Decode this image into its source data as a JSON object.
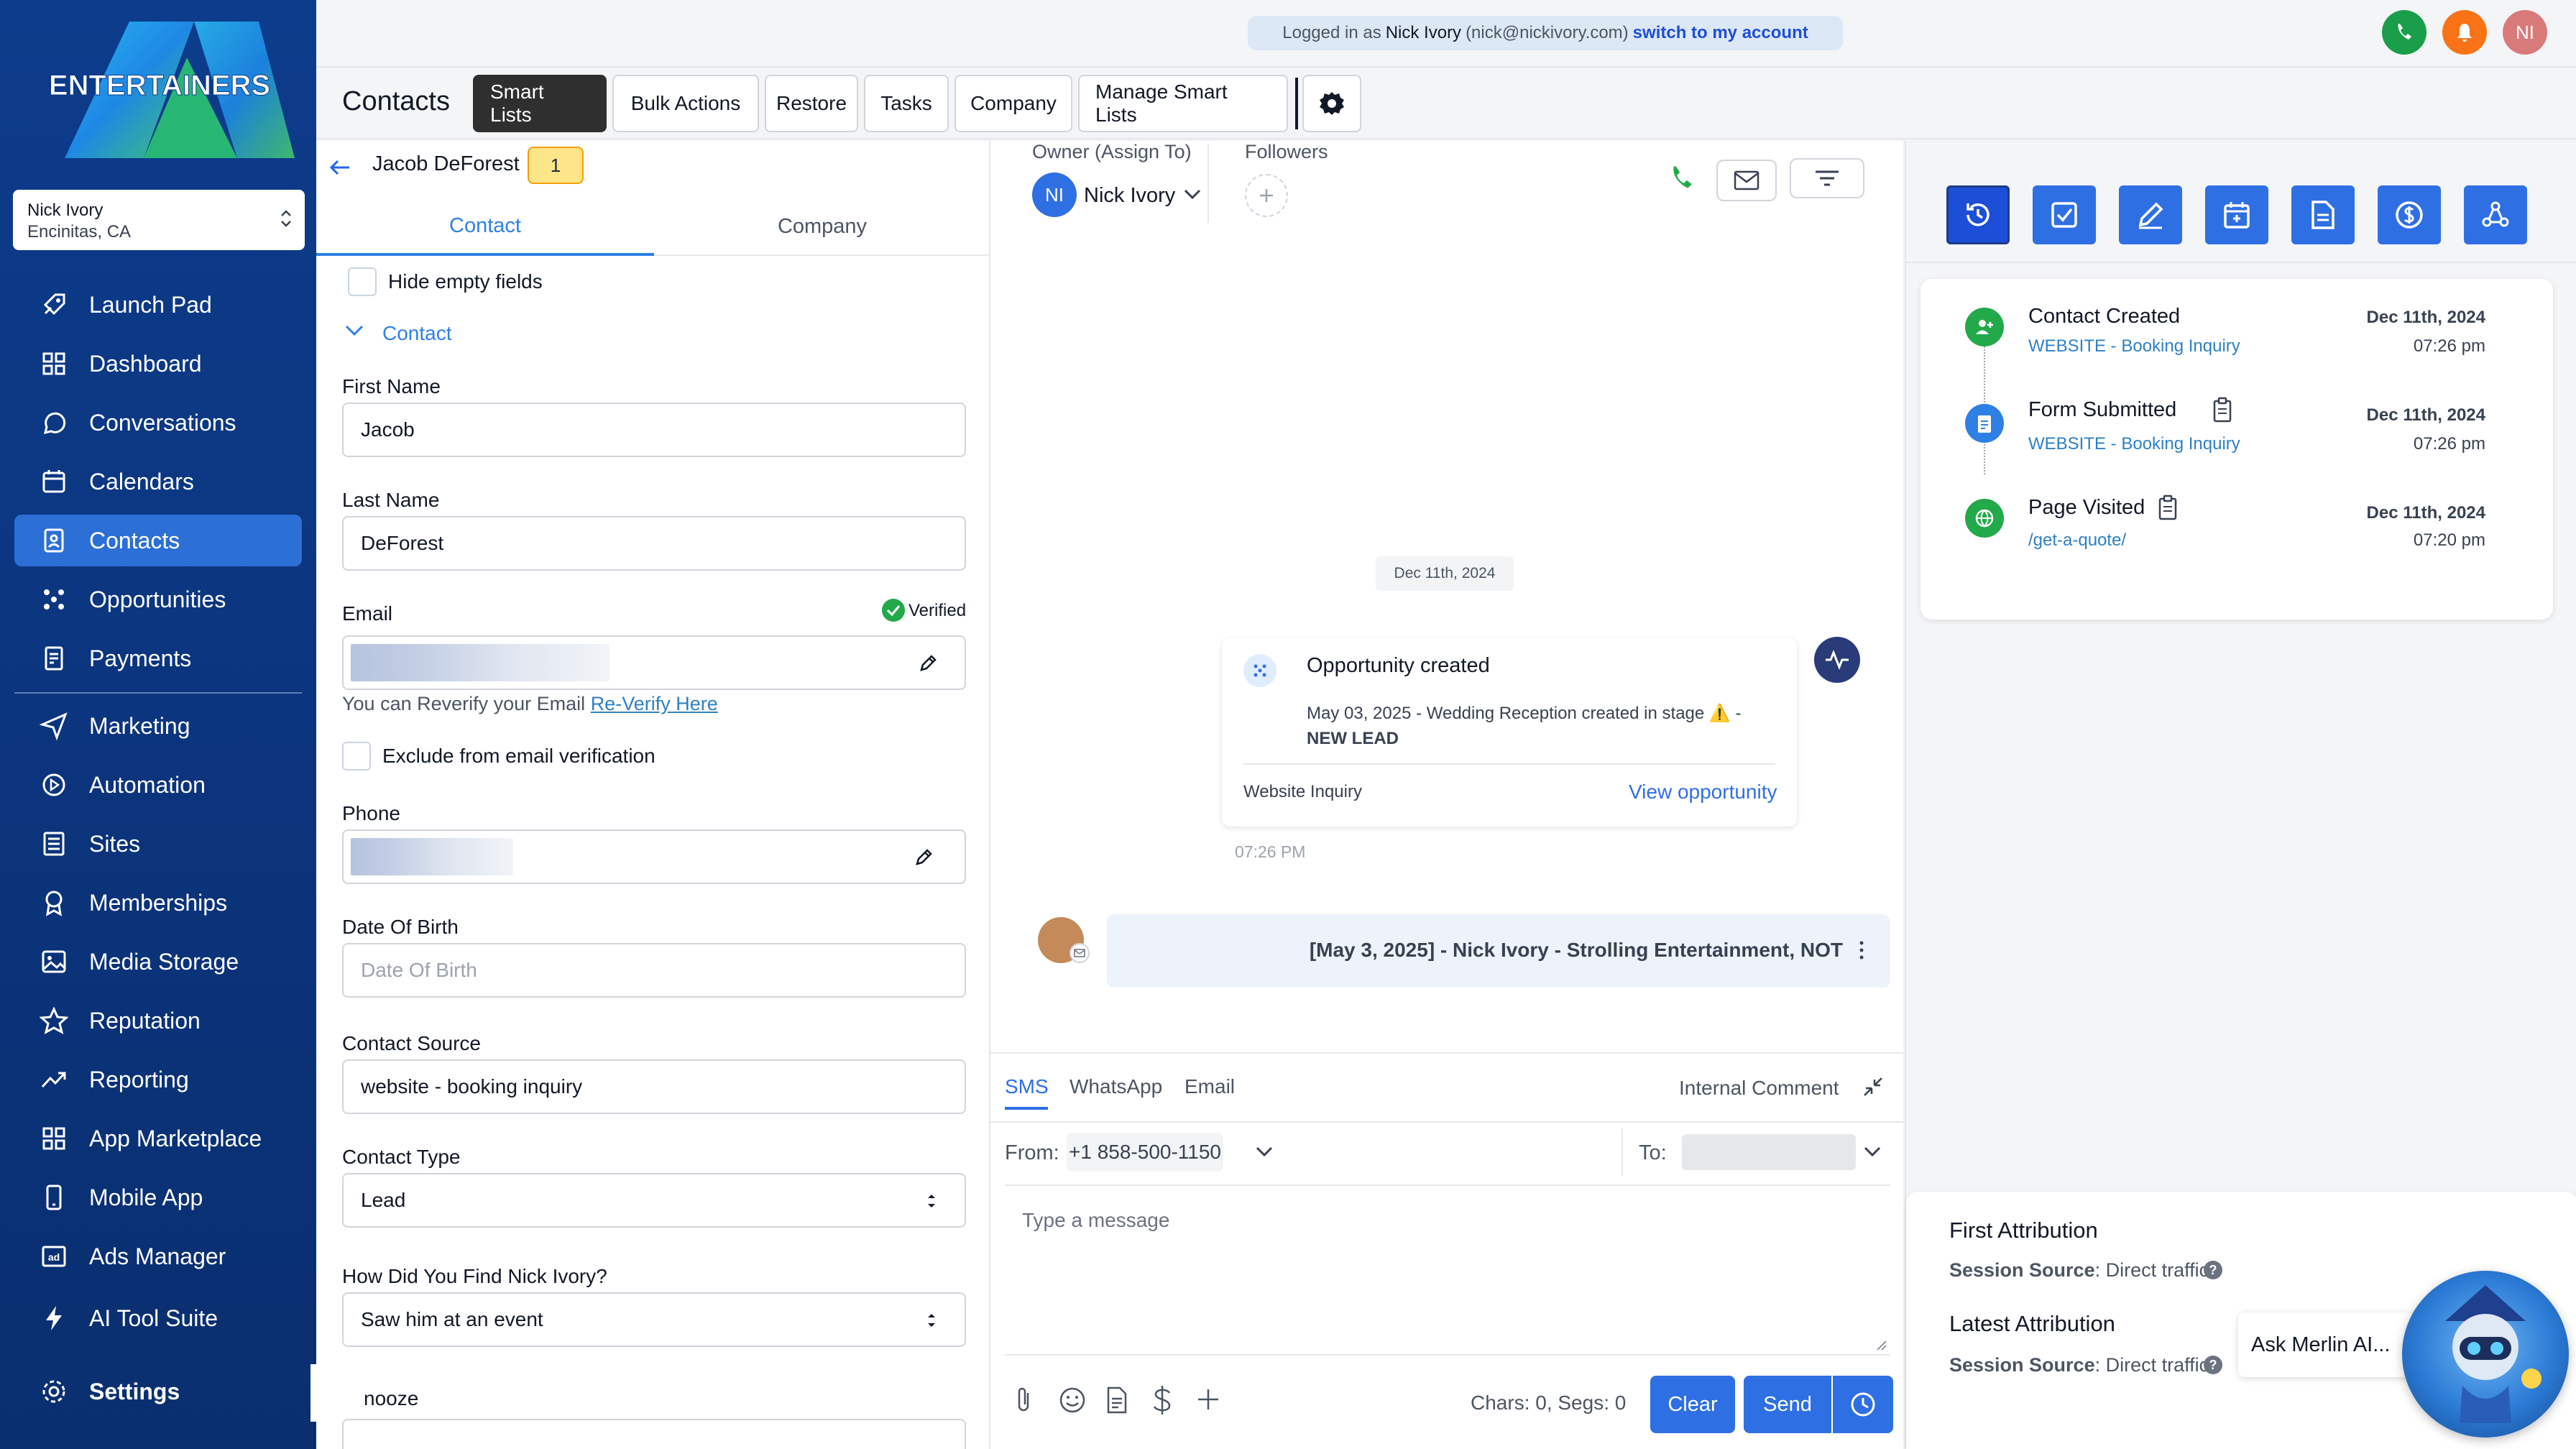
{
  "brand": {
    "logo_text": "ENTERTAINERS",
    "accent": "#2c6fd6",
    "sidebar_bg": "#0d3c8c"
  },
  "account": {
    "name": "Nick Ivory",
    "location": "Encinitas, CA"
  },
  "nav": {
    "items": [
      {
        "label": "Launch Pad",
        "icon": "rocket-icon"
      },
      {
        "label": "Dashboard",
        "icon": "grid-icon"
      },
      {
        "label": "Conversations",
        "icon": "chat-icon"
      },
      {
        "label": "Calendars",
        "icon": "calendar-icon"
      },
      {
        "label": "Contacts",
        "icon": "contacts-icon",
        "active": true
      },
      {
        "label": "Opportunities",
        "icon": "opportunities-icon"
      },
      {
        "label": "Payments",
        "icon": "payments-icon"
      },
      {
        "label": "Marketing",
        "icon": "send-icon"
      },
      {
        "label": "Automation",
        "icon": "automation-icon"
      },
      {
        "label": "Sites",
        "icon": "sites-icon"
      },
      {
        "label": "Memberships",
        "icon": "award-icon"
      },
      {
        "label": "Media Storage",
        "icon": "image-icon"
      },
      {
        "label": "Reputation",
        "icon": "star-icon"
      },
      {
        "label": "Reporting",
        "icon": "trend-icon"
      },
      {
        "label": "App Marketplace",
        "icon": "apps-icon"
      },
      {
        "label": "Mobile App",
        "icon": "phone-icon"
      },
      {
        "label": "Ads Manager",
        "icon": "ads-icon"
      },
      {
        "label": "AI Tool Suite",
        "icon": "bolt-icon"
      }
    ],
    "settings": "Settings"
  },
  "topbar": {
    "logged_in_prefix": "Logged in as",
    "logged_in_name": "Nick Ivory",
    "logged_in_email": "(nick@nickivory.com)",
    "switch_label": "switch to my account",
    "avatar_initials": "NI"
  },
  "toolbar": {
    "title": "Contacts",
    "buttons": [
      "Smart Lists",
      "Bulk Actions",
      "Restore",
      "Tasks",
      "Company",
      "Manage Smart Lists"
    ]
  },
  "contact_panel": {
    "contact_name": "Jacob DeForest",
    "count_badge": "1",
    "tabs": [
      "Contact",
      "Company"
    ],
    "hide_empty_label": "Hide empty fields",
    "section_label": "Contact",
    "first_name": {
      "label": "First Name",
      "value": "Jacob"
    },
    "last_name": {
      "label": "Last Name",
      "value": "DeForest"
    },
    "email": {
      "label": "Email",
      "verified": "Verified",
      "reverify_text": "You can Reverify your Email",
      "reverify_link": "Re-Verify Here"
    },
    "exclude_label": "Exclude from email verification",
    "phone": {
      "label": "Phone"
    },
    "dob": {
      "label": "Date Of Birth",
      "placeholder": "Date Of Birth"
    },
    "source": {
      "label": "Contact Source",
      "value": "website - booking inquiry"
    },
    "type": {
      "label": "Contact Type",
      "value": "Lead"
    },
    "find": {
      "label": "How Did You Find Nick Ivory?",
      "value": "Saw him at an event"
    },
    "snooze_label": "nooze"
  },
  "conversation": {
    "owner_label": "Owner (Assign To)",
    "owner_initials": "NI",
    "owner_name": "Nick Ivory",
    "followers_label": "Followers",
    "date_chip": "Dec 11th, 2024",
    "opportunity": {
      "title": "Opportunity created",
      "body": "May 03, 2025 - Wedding Reception created in stage ⚠️ -",
      "stage": "NEW LEAD",
      "source": "Website Inquiry",
      "link": "View opportunity",
      "time": "07:26 PM"
    },
    "note_text": "[May 3, 2025] - Nick Ivory - Strolling Entertainment, NOT",
    "composer": {
      "tabs": [
        "SMS",
        "WhatsApp",
        "Email"
      ],
      "internal_comment": "Internal Comment",
      "from_label": "From:",
      "from_number": "+1 858-500-1150",
      "to_label": "To:",
      "placeholder": "Type a message",
      "counter": "Chars: 0, Segs: 0",
      "clear": "Clear",
      "send": "Send"
    }
  },
  "activity": {
    "items": [
      {
        "title": "Contact Created",
        "sub": "WEBSITE - Booking Inquiry",
        "date": "Dec 11th, 2024",
        "time": "07:26 pm",
        "color": "#22a94a"
      },
      {
        "title": "Form Submitted",
        "sub": "WEBSITE - Booking Inquiry",
        "date": "Dec 11th, 2024",
        "time": "07:26 pm",
        "color": "#2f80e4"
      },
      {
        "title": "Page Visited",
        "sub": "/get-a-quote/",
        "date": "Dec 11th, 2024",
        "time": "07:20 pm",
        "color": "#22a94a"
      }
    ]
  },
  "attribution": {
    "first_title": "First Attribution",
    "latest_title": "Latest Attribution",
    "session_label": "Session Source",
    "session_value": ": Direct traffic",
    "ask_merlin": "Ask Merlin AI..."
  }
}
